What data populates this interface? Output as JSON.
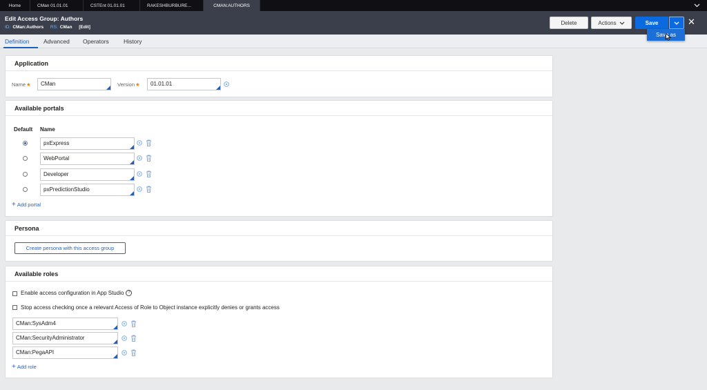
{
  "top_tabs": [
    {
      "label": "Home"
    },
    {
      "label": "CMan 01.01.01"
    },
    {
      "label": "CSTEnt 01.01.01"
    },
    {
      "label": "RAKESHBURBURE..."
    },
    {
      "label": "CMAN:AUTHORS"
    }
  ],
  "header": {
    "edit_label": "Edit",
    "title": "Access Group: Authors",
    "id_key": "ID:",
    "id_value": "CMan:Authors",
    "rs_key": "RS:",
    "rs_value": "CMan",
    "edit_link": "[Edit]",
    "delete_label": "Delete",
    "actions_label": "Actions",
    "save_label": "Save",
    "save_as_label": "Save as"
  },
  "subtabs": [
    "Definition",
    "Advanced",
    "Operators",
    "History"
  ],
  "application": {
    "heading": "Application",
    "name_label": "Name",
    "name_value": "CMan",
    "version_label": "Version",
    "version_value": "01.01.01"
  },
  "portals": {
    "heading": "Available portals",
    "col_default": "Default",
    "col_name": "Name",
    "items": [
      {
        "name": "pxExpress",
        "selected": true
      },
      {
        "name": "WebPortal",
        "selected": false
      },
      {
        "name": "Developer",
        "selected": false
      },
      {
        "name": "pxPredictionStudio",
        "selected": false
      }
    ],
    "add_label": "Add portal"
  },
  "persona": {
    "heading": "Persona",
    "create_label": "Create persona with this access group"
  },
  "roles": {
    "heading": "Available roles",
    "check1": "Enable access configuration in App Studio",
    "help_glyph": "?",
    "check2": "Stop access checking once a relevant Access of Role to Object instance explicitly denies or grants access",
    "items": [
      "CMan:SysAdm4",
      "CMan:SecurityAdministrator",
      "CMan:PegaAPI"
    ],
    "add_label": "Add role"
  },
  "colors": {
    "accent": "#1d5fbf",
    "save_button": "#0c6ae0",
    "header_bg": "#3b3f4b",
    "required": "#e0821f"
  }
}
